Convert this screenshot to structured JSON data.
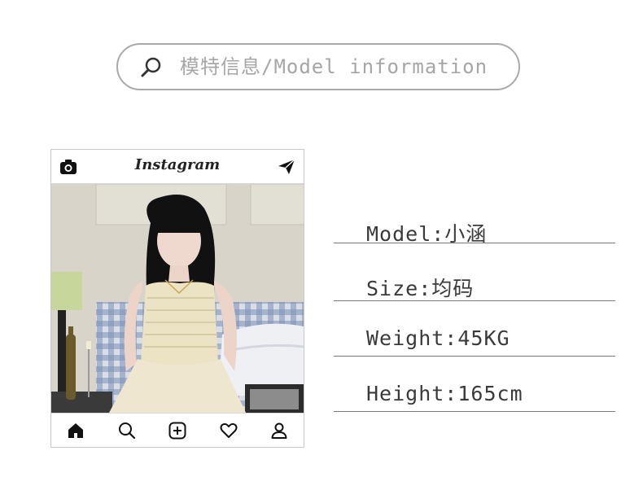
{
  "search": {
    "text": "模特信息/Model information"
  },
  "instagram": {
    "logo": "Instagram",
    "nav_icons": [
      "home-icon",
      "search-icon",
      "add-post-icon",
      "heart-icon",
      "profile-icon"
    ]
  },
  "info": {
    "model": "Model:小涵",
    "size": "Size:均码",
    "weight": "Weight:45KG",
    "height": "Height:165cm"
  }
}
